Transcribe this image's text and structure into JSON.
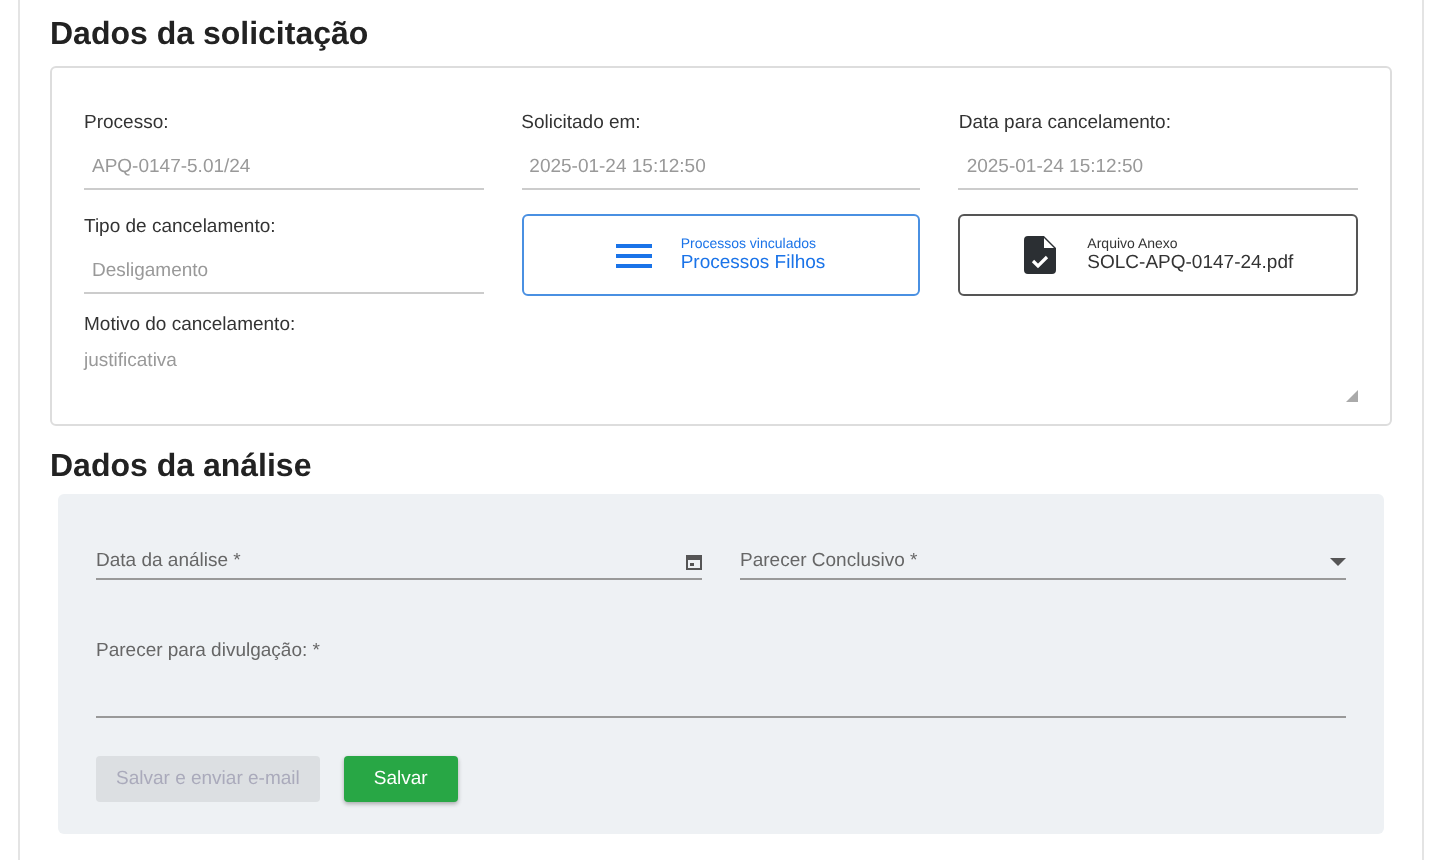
{
  "solicitacao": {
    "title": "Dados da solicitação",
    "fields": [
      {
        "label": "Processo:",
        "value": "APQ-0147-5.01/24"
      },
      {
        "label": "Solicitado em:",
        "value": "2025-01-24 15:12:50"
      },
      {
        "label": "Data para cancelamento:",
        "value": "2025-01-24 15:12:50"
      },
      {
        "label": "Tipo de cancelamento:",
        "value": "Desligamento"
      }
    ],
    "linked_button": {
      "caption": "Processos vinculados",
      "label": "Processos Filhos"
    },
    "attachment": {
      "caption": "Arquivo Anexo",
      "filename": "SOLC-APQ-0147-24.pdf"
    },
    "motivo": {
      "label": "Motivo do cancelamento:",
      "value": "justificativa"
    }
  },
  "analise": {
    "title": "Dados da análise",
    "date_field": {
      "label": "Data da análise *"
    },
    "select_field": {
      "label": "Parecer Conclusivo *"
    },
    "textarea": {
      "label": "Parecer para divulgação: *"
    },
    "buttons": [
      {
        "label": "Salvar e enviar e-mail",
        "disabled": true
      },
      {
        "label": "Salvar",
        "disabled": false
      }
    ]
  }
}
